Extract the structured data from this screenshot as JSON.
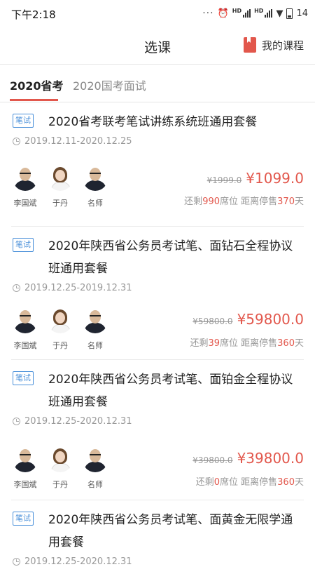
{
  "status": {
    "time": "下午2:18",
    "battery": "14"
  },
  "nav": {
    "title": "选课",
    "my_courses": "我的课程"
  },
  "tabs": [
    {
      "label": "2020省考"
    },
    {
      "label": "2020国考面试"
    }
  ],
  "courses": [
    {
      "tag": "笔试",
      "title": "2020省考联考笔试讲练系统班通用套餐",
      "date": "2019.12.11-2020.12.25",
      "teachers": [
        "李国斌",
        "于丹",
        "名师"
      ],
      "old_price": "¥1999.0",
      "price": "¥1099.0",
      "remain_prefix": "还剩",
      "seats": "990",
      "seats_suffix": "席位 距离停售",
      "days": "370",
      "days_suffix": "天"
    },
    {
      "tag": "笔试",
      "title": "2020年陕西省公务员考试笔、面钻石全程协议班通用套餐",
      "date": "2019.12.25-2019.12.31",
      "teachers": [
        "李国斌",
        "于丹",
        "名师"
      ],
      "old_price": "¥59800.0",
      "price": "¥59800.0",
      "remain_prefix": "还剩",
      "seats": "39",
      "seats_suffix": "席位 距离停售",
      "days": "360",
      "days_suffix": "天"
    },
    {
      "tag": "笔试",
      "title": "2020年陕西省公务员考试笔、面铂金全程协议班通用套餐",
      "date": "2019.12.25-2020.12.31",
      "teachers": [
        "李国斌",
        "于丹",
        "名师"
      ],
      "old_price": "¥39800.0",
      "price": "¥39800.0",
      "remain_prefix": "还剩",
      "seats": "0",
      "seats_suffix": "席位 距离停售",
      "days": "360",
      "days_suffix": "天"
    },
    {
      "tag": "笔试",
      "title": "2020年陕西省公务员考试笔、面黄金无限学通用套餐",
      "date": "2019.12.25-2020.12.31"
    }
  ],
  "colors": {
    "accent": "#e2574c",
    "tag_blue": "#4a90d9"
  }
}
